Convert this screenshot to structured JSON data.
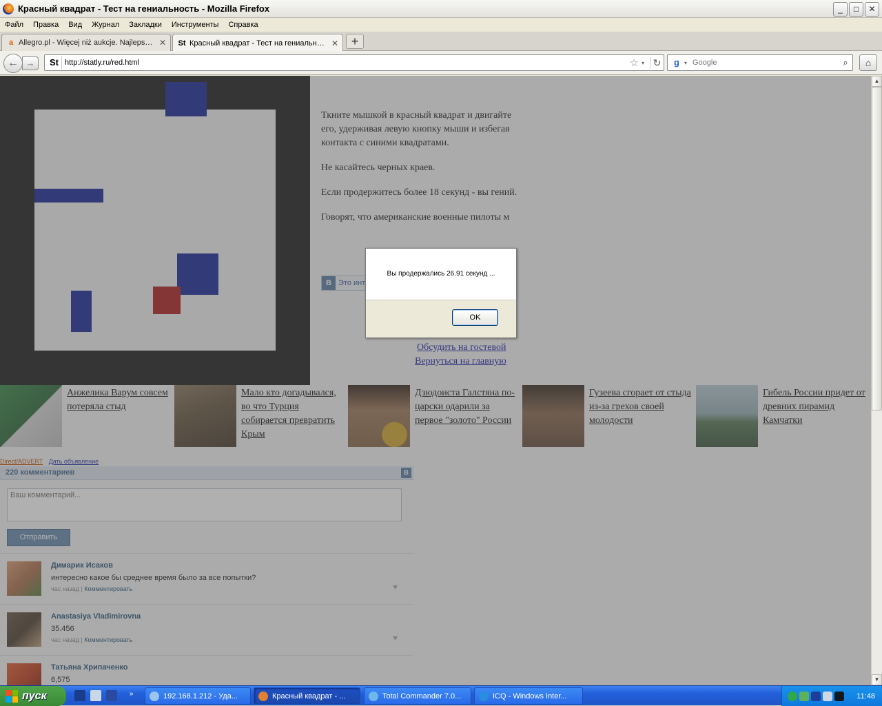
{
  "window": {
    "title": "Красный квадрат - Тест на гениальность - Mozilla Firefox",
    "minimize": "_",
    "maximize": "□",
    "close": "✕"
  },
  "menu": [
    "Файл",
    "Правка",
    "Вид",
    "Журнал",
    "Закладки",
    "Инструменты",
    "Справка"
  ],
  "tabs": [
    {
      "label": "Allegro.pl - Więcej niż aukcje. Najlepsze ...",
      "favicon": "a",
      "close": "✕"
    },
    {
      "label": "Красный квадрат - Тест на гениально...",
      "favicon": "St",
      "close": "✕"
    }
  ],
  "newtab": "+",
  "nav": {
    "back": "←",
    "forward": "→",
    "site_icon": "St",
    "url": "http://statly.ru/red.html",
    "star": "☆",
    "dropdown": "▾",
    "reload": "↻",
    "search_engine": "g",
    "search_placeholder": "Google",
    "search_icon": "⌕",
    "home": "⌂"
  },
  "page": {
    "instructions": [
      "Ткните мышкой в красный квадрат и двигайте его, удерживая левую кнопку мыши и избегая контакта с синими квадратами.",
      "Не касайтесь черных краев.",
      "Если продержитесь более 18 секунд - вы гений.",
      "Говорят, что американские военные пилоты м"
    ],
    "vk_share_icon": "B",
    "vk_share_label": "Это инт",
    "links": {
      "hidden_partial": "",
      "guestbook": "Обсудить на гостевой",
      "home": "Вернуться на главную"
    },
    "news": [
      {
        "caption": "Анжелика Варум совсем потеряла стыд",
        "color": "#2e6a3a"
      },
      {
        "caption": "Мало кто догадывался, во что Турция собирается превратить Крым",
        "color": "#6b5a44"
      },
      {
        "caption": "Дзюдоиста Галстяна по-царски одарили за первое \"золото\" России",
        "color": "#8a6a4a"
      },
      {
        "caption": "Гузеева сгорает от стыда из-за грехов своей молодости",
        "color": "#6a5040"
      },
      {
        "caption": "Гибель России придет от древних пирамид Камчатки",
        "color": "#7a9aa0"
      }
    ],
    "ad": {
      "direct": "Direct/ADVERT",
      "post_ad": "Дать объявление"
    },
    "comments": {
      "count_label": "220 комментариев",
      "vk_icon": "B",
      "placeholder": "Ваш комментарий...",
      "send_label": "Отправить",
      "items": [
        {
          "name": "Димарик Исаков",
          "text": "интересно какое бы среднее время было за все попытки?",
          "time": "час назад",
          "reply": "Комментировать",
          "color": "#b07050"
        },
        {
          "name": "Anastasiya Vladimirovna",
          "text": "35.456",
          "time": "час назад",
          "reply": "Комментировать",
          "color": "#504030"
        },
        {
          "name": "Татьяна Хрипаченко",
          "text": "6,575",
          "time": "",
          "reply": "",
          "color": "#c04020"
        }
      ]
    }
  },
  "dialog": {
    "message": "Вы продержались 26.91 секунд ...",
    "ok_label": "OK"
  },
  "taskbar": {
    "start_label": "пуск",
    "tasks": [
      {
        "label": "192.168.1.212 - Уда...",
        "color": "#9bc4f0"
      },
      {
        "label": "Красный квадрат - ...",
        "color": "#e08030"
      },
      {
        "label": "Total Commander 7.0...",
        "color": "#6fb7e8"
      },
      {
        "label": "ICQ - Windows Inter...",
        "color": "#2a8ee0"
      }
    ],
    "clock": "11:48"
  },
  "scrollbar": {
    "up": "▲",
    "down": "▼"
  }
}
